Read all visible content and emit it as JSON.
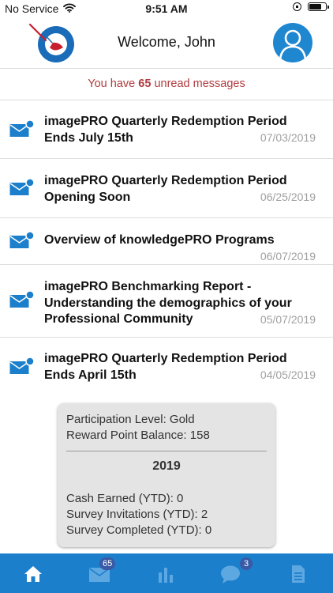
{
  "status_bar": {
    "carrier": "No Service",
    "time": "9:51 AM",
    "battery_level": 0.8
  },
  "header": {
    "welcome": "Welcome, John",
    "logo_icon": "image-pro-logo",
    "profile_icon": "user-avatar-icon"
  },
  "unread": {
    "prefix": "You have",
    "count": "65",
    "suffix": "unread messages"
  },
  "messages": [
    {
      "title": "imagePRO Quarterly Redemption Period Ends July 15th",
      "date": "07/03/2019"
    },
    {
      "title": "imagePRO Quarterly Redemption Period Opening Soon",
      "date": "06/25/2019"
    },
    {
      "title": "Overview of knowledgePRO Programs",
      "date": "06/07/2019"
    },
    {
      "title": "imagePRO Benchmarking Report - Understanding the demographics of your Professional Community",
      "date": "05/07/2019"
    },
    {
      "title": "imagePRO Quarterly Redemption Period Ends April 15th",
      "date": "04/05/2019"
    }
  ],
  "summary": {
    "participation": "Participation Level: Gold",
    "balance": "Reward Point Balance: 158",
    "year": "2019",
    "cash": "Cash Earned (YTD): 0",
    "invitations": "Survey Invitations (YTD): 2",
    "completed": "Survey Completed (YTD): 0"
  },
  "tabs": [
    {
      "icon": "home-icon",
      "badge": ""
    },
    {
      "icon": "mail-icon",
      "badge": "65"
    },
    {
      "icon": "bar-chart-icon",
      "badge": ""
    },
    {
      "icon": "chat-icon",
      "badge": "3"
    },
    {
      "icon": "document-icon",
      "badge": ""
    }
  ],
  "colors": {
    "accent_blue": "#1b7fcc",
    "unread_red": "#b23a3e",
    "date_gray": "#a0a0a0",
    "card_gray": "#e4e4e4"
  }
}
